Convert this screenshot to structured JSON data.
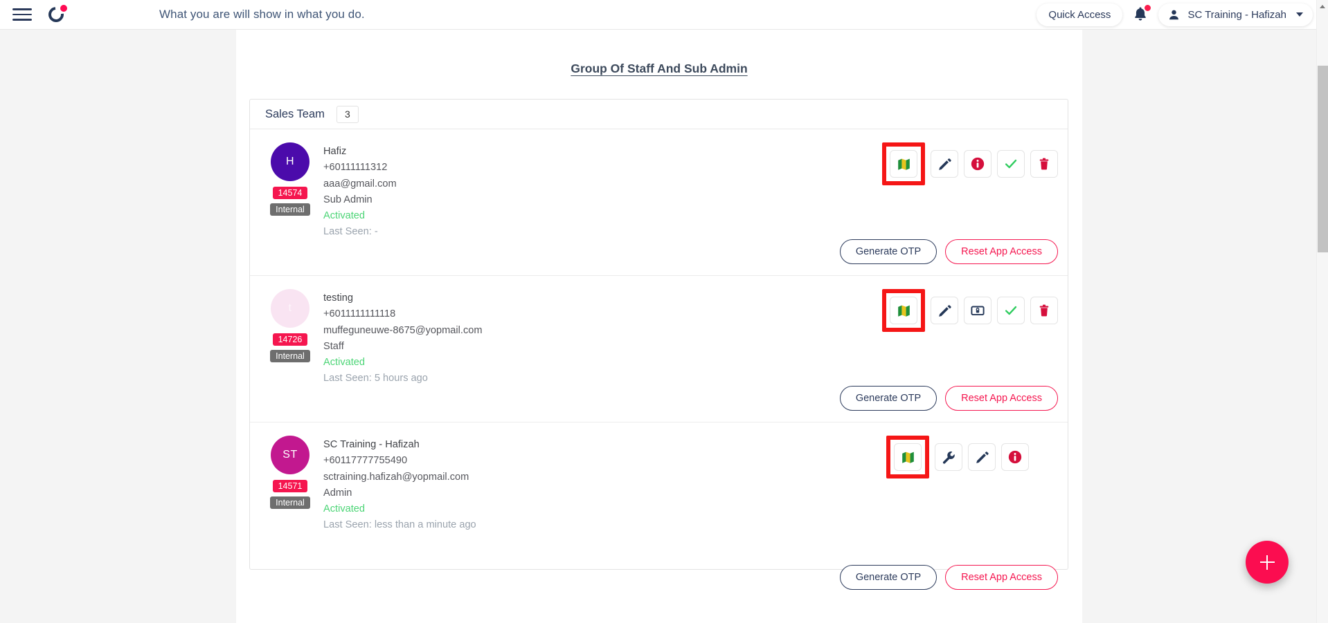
{
  "header": {
    "menu_icon": "hamburger-icon",
    "logo_icon": "brand-logo-icon",
    "tagline": "What you are will show in what you do.",
    "quick_access_label": "Quick Access",
    "notification_icon": "bell-icon",
    "user_name": "SC Training - Hafizah",
    "user_icon": "person-icon",
    "chevron_icon": "chevron-down-icon",
    "accent_color": "#fb0d50",
    "navy_color": "#2b3a5b"
  },
  "main": {
    "page_title": "Group Of Staff And Sub Admin",
    "group": {
      "name": "Sales Team",
      "count": "3"
    },
    "members": [
      {
        "initials": "H",
        "avatar_color": "#4b0bab",
        "avatar_text_color": "#ffffff",
        "id": "14574",
        "type": "Internal",
        "name": "Hafiz",
        "phone": "+60111111312",
        "email": "aaa@gmail.com",
        "role": "Sub Admin",
        "status": "Activated",
        "last_seen": "Last Seen: -",
        "actions": [
          {
            "icon": "map-icon",
            "highlighted": true
          },
          {
            "icon": "pencil-icon",
            "highlighted": false
          },
          {
            "icon": "info-icon",
            "highlighted": false
          },
          {
            "icon": "check-icon",
            "highlighted": false
          },
          {
            "icon": "trash-icon",
            "highlighted": false
          }
        ],
        "buttons": {
          "otp_label": "Generate OTP",
          "reset_label": "Reset App Access"
        }
      },
      {
        "initials": "t",
        "avatar_color": "#f9e4f2",
        "avatar_text_color": "#fdf4fa",
        "id": "14726",
        "type": "Internal",
        "name": "testing",
        "phone": "+6011111111118",
        "email": "muffeguneuwe-8675@yopmail.com",
        "role": "Staff",
        "status": "Activated",
        "last_seen": "Last Seen: 5 hours ago",
        "actions": [
          {
            "icon": "map-icon",
            "highlighted": true
          },
          {
            "icon": "pencil-icon",
            "highlighted": false
          },
          {
            "icon": "lock-badge-icon",
            "highlighted": false
          },
          {
            "icon": "check-icon",
            "highlighted": false
          },
          {
            "icon": "trash-icon",
            "highlighted": false
          }
        ],
        "buttons": {
          "otp_label": "Generate OTP",
          "reset_label": "Reset App Access"
        }
      },
      {
        "initials": "ST",
        "avatar_color": "#c2188f",
        "avatar_text_color": "#ffffff",
        "id": "14571",
        "type": "Internal",
        "name": "SC Training - Hafizah",
        "phone": "+60117777755490",
        "email": "sctraining.hafizah@yopmail.com",
        "role": "Admin",
        "status": "Activated",
        "last_seen": "Last Seen: less than a minute ago",
        "actions": [
          {
            "icon": "map-icon",
            "highlighted": true
          },
          {
            "icon": "wrench-icon",
            "highlighted": false
          },
          {
            "icon": "pencil-icon",
            "highlighted": false
          },
          {
            "icon": "info-icon",
            "highlighted": false
          }
        ],
        "buttons": {
          "otp_label": "Generate OTP",
          "reset_label": "Reset App Access"
        }
      }
    ]
  },
  "fab": {
    "icon": "plus-icon",
    "color": "#fb0d50"
  },
  "scrollbar": {
    "up_arrow_icon": "scroll-up-arrow-icon"
  }
}
